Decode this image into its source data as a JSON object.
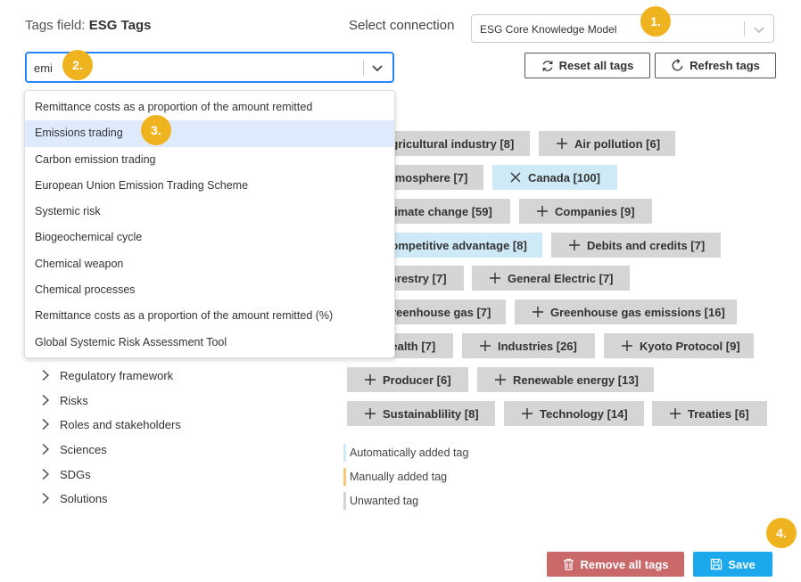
{
  "header": {
    "field_label": "Tags field:",
    "field_name": "ESG Tags",
    "select_connection_label": "Select connection"
  },
  "connection": {
    "value": "ESG Core Knowledge Model"
  },
  "search": {
    "value": "emi"
  },
  "buttons": {
    "reset_all": "Reset all tags",
    "refresh": "Refresh tags",
    "remove_all": "Remove all tags",
    "save": "Save"
  },
  "dropdown": {
    "options": [
      "Remittance costs as a proportion of the amount remitted",
      "Emissions trading",
      "Carbon emission trading",
      "European Union Emission Trading Scheme",
      "Systemic risk",
      "Biogeochemical cycle",
      "Chemical weapon",
      "Chemical processes",
      "Remittance costs as a proportion of the amount remitted (%)",
      "Global Systemic Risk Assessment Tool"
    ]
  },
  "tree": {
    "items": [
      "Regulatory framework",
      "Risks",
      "Roles and stakeholders",
      "Sciences",
      "SDGs",
      "Solutions"
    ]
  },
  "tags": [
    {
      "label": "Agricultural industry [8]",
      "icon": "plus-icon",
      "type": "unwanted"
    },
    {
      "label": "Air pollution [6]",
      "icon": "plus-icon",
      "type": "unwanted"
    },
    {
      "label": "Atmosphere [7]",
      "icon": "plus-icon",
      "type": "unwanted"
    },
    {
      "label": "Canada [100]",
      "icon": "close-icon",
      "type": "auto"
    },
    {
      "label": "Climate change [59]",
      "icon": "plus-icon",
      "type": "unwanted"
    },
    {
      "label": "Companies [9]",
      "icon": "plus-icon",
      "type": "unwanted"
    },
    {
      "label": "Competitive advantage [8]",
      "icon": "close-icon",
      "type": "auto"
    },
    {
      "label": "Debits and credits [7]",
      "icon": "plus-icon",
      "type": "unwanted"
    },
    {
      "label": "Forestry [7]",
      "icon": "plus-icon",
      "type": "unwanted"
    },
    {
      "label": "General Electric [7]",
      "icon": "plus-icon",
      "type": "unwanted"
    },
    {
      "label": "Greenhouse gas [7]",
      "icon": "plus-icon",
      "type": "unwanted"
    },
    {
      "label": "Greenhouse gas emissions [16]",
      "icon": "plus-icon",
      "type": "unwanted"
    },
    {
      "label": "Health [7]",
      "icon": "plus-icon",
      "type": "unwanted"
    },
    {
      "label": "Industries [26]",
      "icon": "plus-icon",
      "type": "unwanted"
    },
    {
      "label": "Kyoto Protocol [9]",
      "icon": "plus-icon",
      "type": "unwanted"
    },
    {
      "label": "Producer [6]",
      "icon": "plus-icon",
      "type": "unwanted"
    },
    {
      "label": "Renewable energy [13]",
      "icon": "plus-icon",
      "type": "unwanted"
    },
    {
      "label": "Sustainablility [8]",
      "icon": "plus-icon",
      "type": "unwanted"
    },
    {
      "label": "Technology [14]",
      "icon": "plus-icon",
      "type": "unwanted"
    },
    {
      "label": "Treaties [6]",
      "icon": "plus-icon",
      "type": "unwanted"
    }
  ],
  "legend": [
    {
      "label": "Automatically added tag",
      "color": "#cfeaf7"
    },
    {
      "label": "Manually added tag",
      "color": "#f5c97a"
    },
    {
      "label": "Unwanted tag",
      "color": "#d5d5d5"
    }
  ],
  "markers": [
    "1.",
    "2.",
    "3.",
    "4."
  ],
  "colors": {
    "auto_tag": "#cfeaf7",
    "unwanted_tag": "#d5d5d5",
    "manual_tag": "#f5c97a",
    "remove_button": "#c9696a",
    "save_button": "#1ca8ec",
    "marker": "#f0b320",
    "highlight": "#deebff",
    "focus": "#2684ff"
  }
}
